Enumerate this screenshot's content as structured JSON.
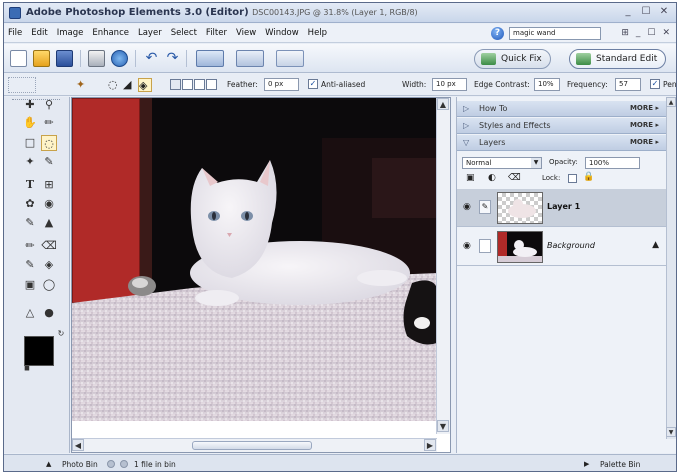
{
  "window": {
    "app_title": "Adobe Photoshop Elements 3.0 (Editor)",
    "doc_title": "DSC00143.JPG @ 31.8% (Layer 1, RGB/8)",
    "controls": [
      "_",
      "☐",
      "✕"
    ]
  },
  "menu": {
    "items": [
      "File",
      "Edit",
      "Image",
      "Enhance",
      "Layer",
      "Select",
      "Filter",
      "View",
      "Window",
      "Help"
    ],
    "search_value": "magic wand",
    "mini_controls": [
      "⊞",
      "_",
      "☐",
      "✕"
    ]
  },
  "modes": {
    "quick_fix": "Quick Fix",
    "standard_edit": "Standard Edit"
  },
  "options": {
    "feather_label": "Feather:",
    "feather_value": "0 px",
    "antialiased_label": "Anti-aliased",
    "width_label": "Width:",
    "width_value": "10 px",
    "edge_contrast_label": "Edge Contrast:",
    "edge_contrast_value": "10%",
    "frequency_label": "Frequency:",
    "frequency_value": "57",
    "pen_label": "Pen"
  },
  "palettes": {
    "panels": [
      {
        "label": "How To",
        "more": "MORE"
      },
      {
        "label": "Styles and Effects",
        "more": "MORE"
      },
      {
        "label": "Layers",
        "more": "MORE"
      }
    ],
    "blend_mode": "Normal",
    "opacity_label": "Opacity:",
    "opacity_value": "100%",
    "lock_label": "Lock:",
    "layers": [
      {
        "name": "Layer 1",
        "selected": true
      },
      {
        "name": "Background",
        "selected": false
      }
    ]
  },
  "status": {
    "photo_bin": "Photo Bin",
    "file_count": "1 file in bin",
    "palette_bin": "Palette Bin"
  },
  "colors": {
    "accent": "#3b6cb4",
    "foreground": "#000000",
    "background": "#ffffff",
    "selected_layer": "#c7cfdb"
  }
}
